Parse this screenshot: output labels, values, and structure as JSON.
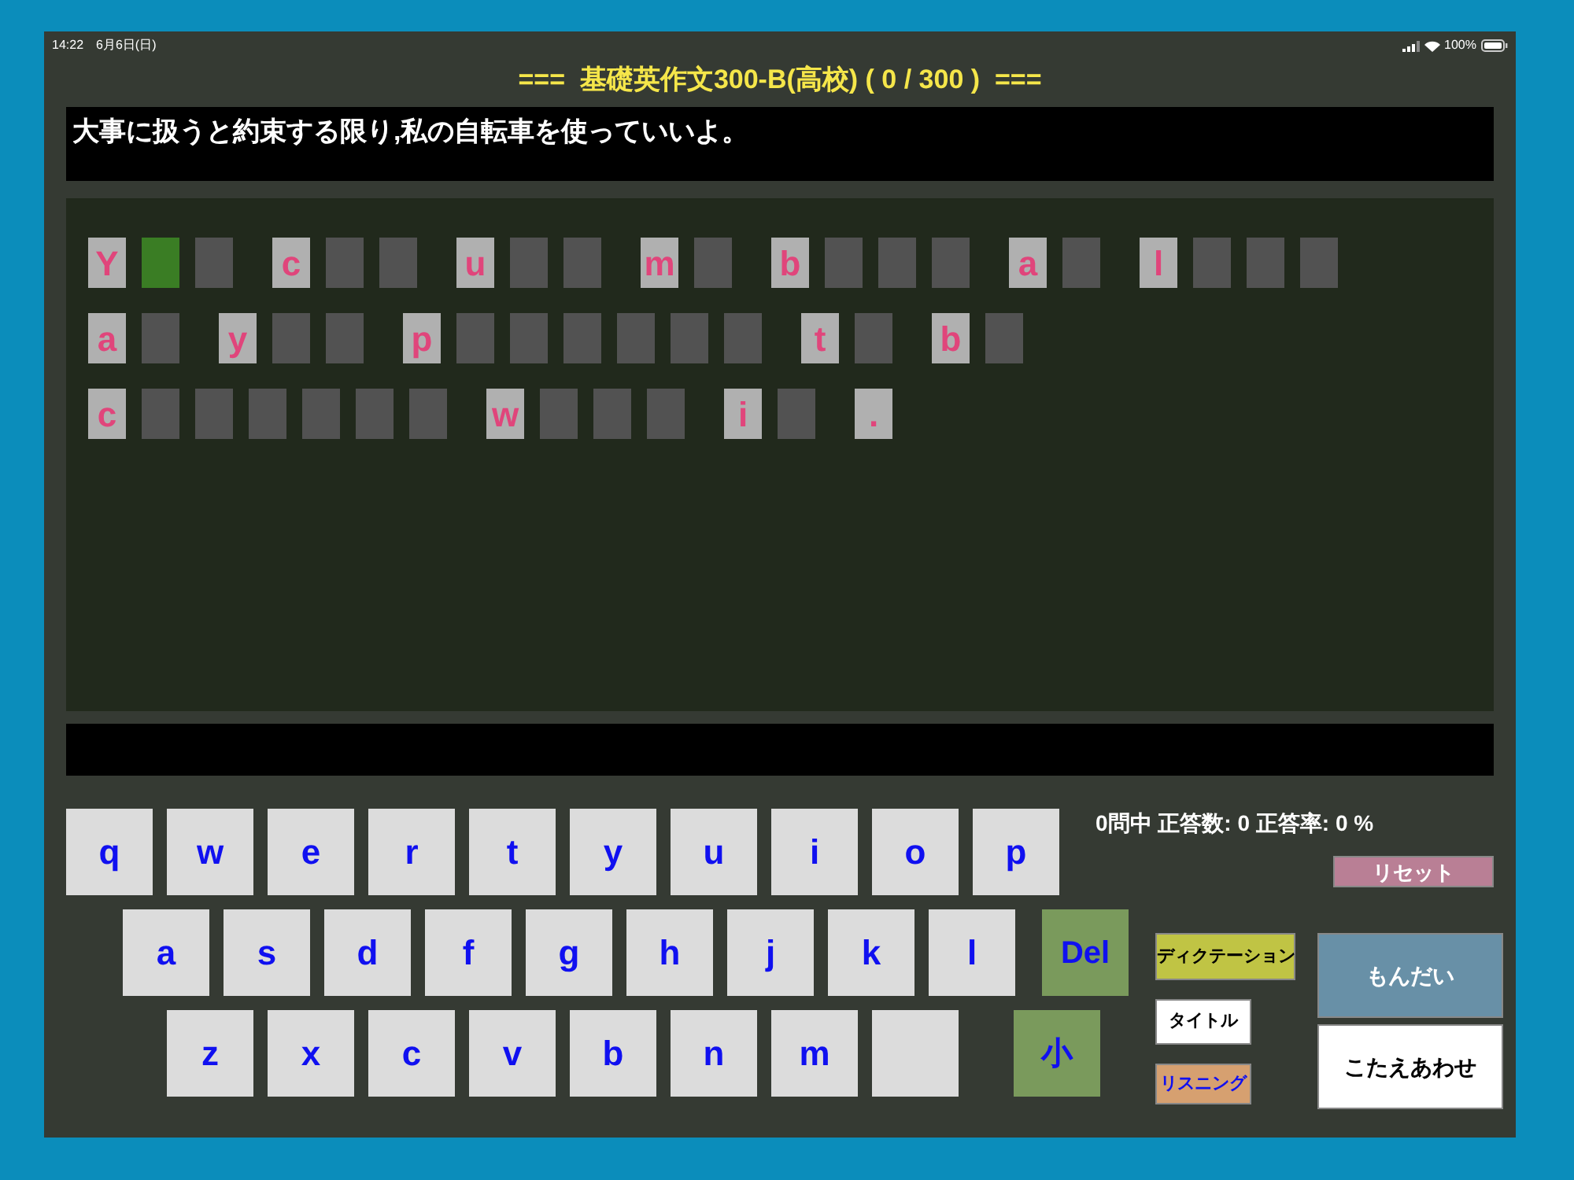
{
  "status_bar": {
    "time": "14:22",
    "date": "6月6日(日)",
    "battery": "100%"
  },
  "title": "===  基礎英作文300-B(高校) ( 0 / 300 )  ===",
  "prompt": "大事に扱うと約束する限り,私の自転車を使っていいよ。",
  "answer_rows": [
    [
      [
        {
          "kind": "hint",
          "text": "Y"
        },
        {
          "kind": "blank",
          "selected": true
        },
        {
          "kind": "blank",
          "selected": false
        }
      ],
      [
        {
          "kind": "hint",
          "text": "c"
        },
        {
          "kind": "blank",
          "selected": false
        },
        {
          "kind": "blank",
          "selected": false
        }
      ],
      [
        {
          "kind": "hint",
          "text": "u"
        },
        {
          "kind": "blank",
          "selected": false
        },
        {
          "kind": "blank",
          "selected": false
        }
      ],
      [
        {
          "kind": "hint",
          "text": "m"
        },
        {
          "kind": "blank",
          "selected": false
        }
      ],
      [
        {
          "kind": "hint",
          "text": "b"
        },
        {
          "kind": "blank",
          "selected": false
        },
        {
          "kind": "blank",
          "selected": false
        },
        {
          "kind": "blank",
          "selected": false
        }
      ],
      [
        {
          "kind": "hint",
          "text": "a"
        },
        {
          "kind": "blank",
          "selected": false
        }
      ],
      [
        {
          "kind": "hint",
          "text": "l"
        },
        {
          "kind": "blank",
          "selected": false
        },
        {
          "kind": "blank",
          "selected": false
        },
        {
          "kind": "blank",
          "selected": false
        }
      ]
    ],
    [
      [
        {
          "kind": "hint",
          "text": "a"
        },
        {
          "kind": "blank",
          "selected": false
        }
      ],
      [
        {
          "kind": "hint",
          "text": "y"
        },
        {
          "kind": "blank",
          "selected": false
        },
        {
          "kind": "blank",
          "selected": false
        }
      ],
      [
        {
          "kind": "hint",
          "text": "p"
        },
        {
          "kind": "blank",
          "selected": false
        },
        {
          "kind": "blank",
          "selected": false
        },
        {
          "kind": "blank",
          "selected": false
        },
        {
          "kind": "blank",
          "selected": false
        },
        {
          "kind": "blank",
          "selected": false
        },
        {
          "kind": "blank",
          "selected": false
        }
      ],
      [
        {
          "kind": "hint",
          "text": "t"
        },
        {
          "kind": "blank",
          "selected": false
        }
      ],
      [
        {
          "kind": "hint",
          "text": "b"
        },
        {
          "kind": "blank",
          "selected": false
        }
      ]
    ],
    [
      [
        {
          "kind": "hint",
          "text": "c"
        },
        {
          "kind": "blank",
          "selected": false
        },
        {
          "kind": "blank",
          "selected": false
        },
        {
          "kind": "blank",
          "selected": false
        },
        {
          "kind": "blank",
          "selected": false
        },
        {
          "kind": "blank",
          "selected": false
        },
        {
          "kind": "blank",
          "selected": false
        }
      ],
      [
        {
          "kind": "hint",
          "text": "w"
        },
        {
          "kind": "blank",
          "selected": false
        },
        {
          "kind": "blank",
          "selected": false
        },
        {
          "kind": "blank",
          "selected": false
        }
      ],
      [
        {
          "kind": "hint",
          "text": "i"
        },
        {
          "kind": "blank",
          "selected": false
        }
      ],
      [
        {
          "kind": "hint",
          "text": "."
        }
      ]
    ]
  ],
  "keyboard": [
    [
      {
        "kind": "letter",
        "label": "q"
      },
      {
        "kind": "letter",
        "label": "w"
      },
      {
        "kind": "letter",
        "label": "e"
      },
      {
        "kind": "letter",
        "label": "r"
      },
      {
        "kind": "letter",
        "label": "t"
      },
      {
        "kind": "letter",
        "label": "y"
      },
      {
        "kind": "letter",
        "label": "u"
      },
      {
        "kind": "letter",
        "label": "i"
      },
      {
        "kind": "letter",
        "label": "o"
      },
      {
        "kind": "letter",
        "label": "p"
      }
    ],
    [
      {
        "kind": "letter",
        "label": "a"
      },
      {
        "kind": "letter",
        "label": "s"
      },
      {
        "kind": "letter",
        "label": "d"
      },
      {
        "kind": "letter",
        "label": "f"
      },
      {
        "kind": "letter",
        "label": "g"
      },
      {
        "kind": "letter",
        "label": "h"
      },
      {
        "kind": "letter",
        "label": "j"
      },
      {
        "kind": "letter",
        "label": "k"
      },
      {
        "kind": "letter",
        "label": "l"
      },
      {
        "kind": "function",
        "label": "Del"
      }
    ],
    [
      {
        "kind": "letter",
        "label": "z"
      },
      {
        "kind": "letter",
        "label": "x"
      },
      {
        "kind": "letter",
        "label": "c"
      },
      {
        "kind": "letter",
        "label": "v"
      },
      {
        "kind": "letter",
        "label": "b"
      },
      {
        "kind": "letter",
        "label": "n"
      },
      {
        "kind": "letter",
        "label": "m"
      },
      {
        "kind": "blank"
      },
      {
        "kind": "function",
        "label": "小"
      }
    ]
  ],
  "stats": "0問中 正答数: 0 正答率: 0 %",
  "reset_button": "リセット",
  "mode_buttons": [
    {
      "label": "ディクテーション",
      "color": "#c0c444"
    },
    {
      "label": "タイトル",
      "color": "#ffffff"
    },
    {
      "label": "リスニング",
      "color": "#d6a070"
    }
  ],
  "question_button": "もんだい",
  "check_button": "こたえあわせ"
}
